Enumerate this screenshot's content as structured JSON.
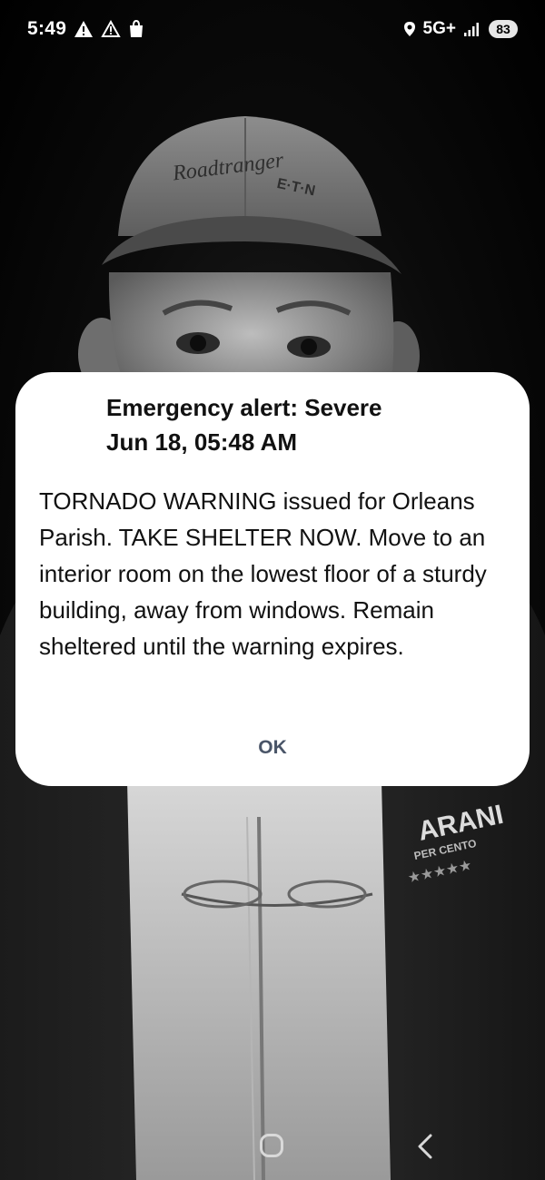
{
  "status_bar": {
    "time": "5:49",
    "network": "5G+",
    "battery": "83",
    "left_icons": [
      "warning-filled-icon",
      "warning-outline-icon",
      "shopping-bag-icon"
    ],
    "right_icons": [
      "location-icon",
      "signal-bars-icon"
    ]
  },
  "alert": {
    "title": "Emergency alert: Severe",
    "date": "Jun 18, 05:48 AM",
    "message": "TORNADO WARNING issued for Orleans Parish. TAKE SHELTER NOW. Move to an interior room on the lowest floor of a sturdy building, away from windows. Remain sheltered until the warning expires.",
    "ok_label": "OK"
  },
  "wallpaper": {
    "hat_text": "Roadtranger",
    "hat_logo": "E·T·N",
    "shirt_text": "ARANI",
    "shirt_subtext": "PER CENTO"
  },
  "nav_bar": {
    "icons": [
      "home-icon",
      "back-icon"
    ]
  },
  "colors": {
    "dialog_background": "#ffffff",
    "ok_text": "#4a5568",
    "battery_pill": "#e6e6e6"
  }
}
